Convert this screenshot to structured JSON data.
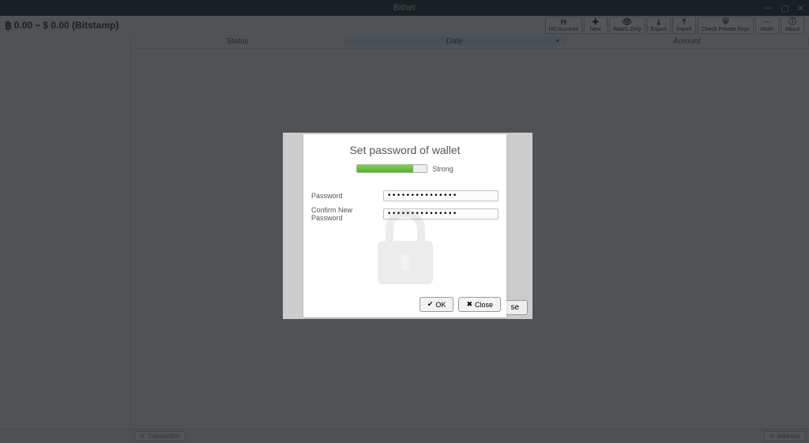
{
  "window": {
    "title": "Bither"
  },
  "balance": {
    "btc_symbol": "฿",
    "btc_value": "0.00",
    "sep": "~",
    "fiat": "$ 0.00 (Bitstamp)"
  },
  "toolbar": {
    "hd_account": "HD Account",
    "new": "New",
    "watch_only": "Watch Only",
    "export": "Export",
    "import": "Import",
    "check_private_keys": "Check Private Keys",
    "more": "More",
    "about": "About"
  },
  "columns": {
    "status": "Status",
    "date": "Date",
    "amount": "Amount"
  },
  "bottom": {
    "transaction": "Transaction",
    "address": "Address"
  },
  "outer_dialog": {
    "close": "se"
  },
  "modal": {
    "title": "Set password of wallet",
    "strength_label": "Strong",
    "strength_percent": 80,
    "password_label": "Password",
    "confirm_label": "Confirm New Password",
    "password_value": "•••••••••••••••",
    "confirm_value": "•••••••••••••••",
    "ok": "OK",
    "close": "Close"
  }
}
